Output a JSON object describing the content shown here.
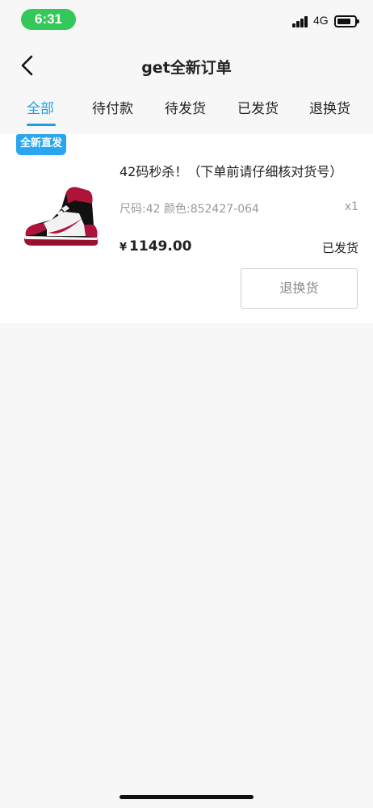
{
  "status_bar": {
    "time": "6:31",
    "network": "4G"
  },
  "nav": {
    "title": "get全新订单"
  },
  "tabs": [
    {
      "label": "全部",
      "active": true
    },
    {
      "label": "待付款",
      "active": false
    },
    {
      "label": "待发货",
      "active": false
    },
    {
      "label": "已发货",
      "active": false
    },
    {
      "label": "退换货",
      "active": false
    }
  ],
  "order": {
    "badge": "全新直发",
    "title": "42码秒杀！（下单前请仔细核对货号）",
    "spec": "尺码:42 颜色:852427-064",
    "quantity": "x1",
    "currency": "¥",
    "price": "1149.00",
    "status": "已发货",
    "action_label": "退换货"
  },
  "colors": {
    "accent": "#1a9ee8",
    "badge": "#2aa6ef",
    "time_pill": "#34c759",
    "background": "#f7f7f7"
  }
}
